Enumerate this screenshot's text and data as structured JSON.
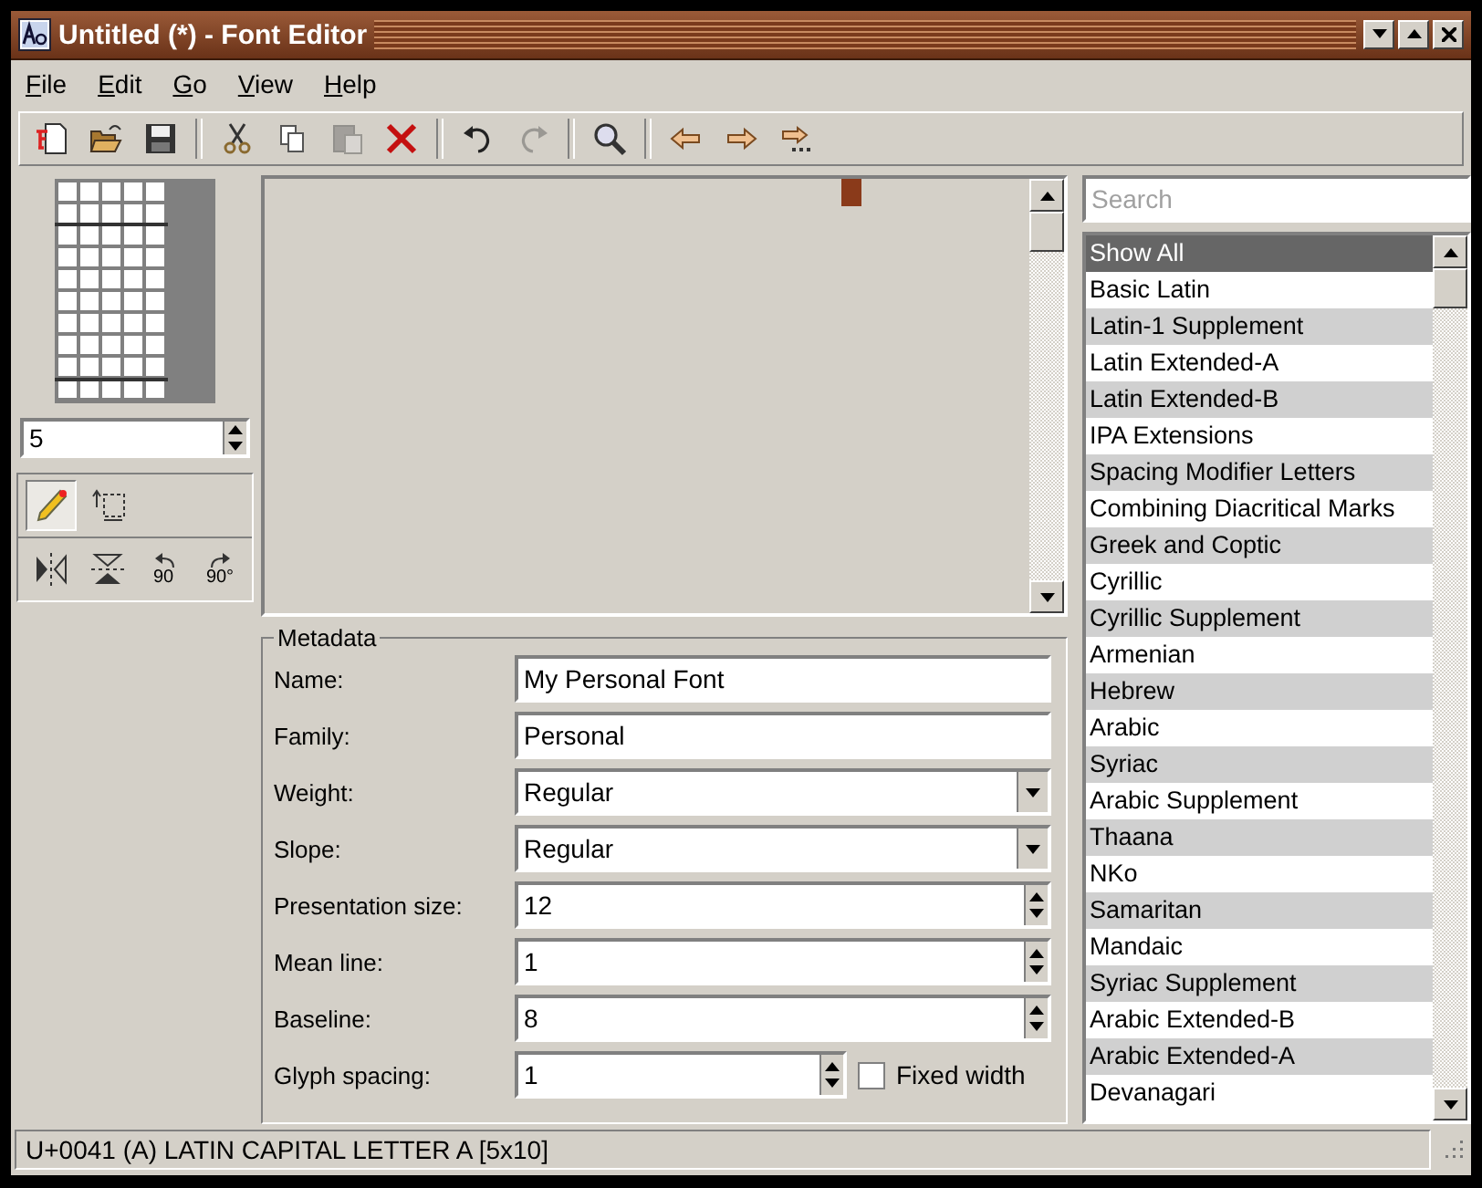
{
  "window": {
    "title": "Untitled (*) - Font Editor"
  },
  "menu": [
    "File",
    "Edit",
    "Go",
    "View",
    "Help"
  ],
  "toolbar": [
    {
      "kind": "new",
      "disabled": false
    },
    {
      "kind": "open",
      "disabled": false
    },
    {
      "kind": "save",
      "disabled": false
    },
    {
      "kind": "sep"
    },
    {
      "kind": "cut",
      "disabled": false
    },
    {
      "kind": "copy",
      "disabled": false
    },
    {
      "kind": "paste",
      "disabled": true
    },
    {
      "kind": "delete",
      "disabled": false
    },
    {
      "kind": "sep"
    },
    {
      "kind": "undo",
      "disabled": false
    },
    {
      "kind": "redo",
      "disabled": true
    },
    {
      "kind": "sep"
    },
    {
      "kind": "find",
      "disabled": false
    },
    {
      "kind": "sep"
    },
    {
      "kind": "back",
      "disabled": false
    },
    {
      "kind": "forward",
      "disabled": false
    },
    {
      "kind": "goto",
      "disabled": false
    }
  ],
  "glyph_width": {
    "value": "5"
  },
  "draw_tools": [
    {
      "kind": "pencil",
      "selected": true
    },
    {
      "kind": "select",
      "selected": false
    }
  ],
  "transform_tools": [
    {
      "kind": "flip-h"
    },
    {
      "kind": "flip-v"
    },
    {
      "kind": "rotate-left",
      "label": "90"
    },
    {
      "kind": "rotate-right",
      "label": "90°"
    }
  ],
  "metadata": {
    "title": "Metadata",
    "fields": [
      {
        "label": "Name:",
        "kind": "text",
        "value": "My Personal Font"
      },
      {
        "label": "Family:",
        "kind": "text",
        "value": "Personal"
      },
      {
        "label": "Weight:",
        "kind": "select",
        "value": "Regular"
      },
      {
        "label": "Slope:",
        "kind": "select",
        "value": "Regular"
      },
      {
        "label": "Presentation size:",
        "kind": "spin",
        "value": "12"
      },
      {
        "label": "Mean line:",
        "kind": "spin",
        "value": "1"
      },
      {
        "label": "Baseline:",
        "kind": "spin",
        "value": "8"
      },
      {
        "label": "Glyph spacing:",
        "kind": "spin-check",
        "value": "1",
        "check_label": "Fixed width",
        "checked": false
      }
    ]
  },
  "search": {
    "placeholder": "Search"
  },
  "blocks": [
    {
      "label": "Show All",
      "selected": true
    },
    {
      "label": "Basic Latin",
      "selected": false
    },
    {
      "label": "Latin-1 Supplement",
      "selected": false
    },
    {
      "label": "Latin Extended-A",
      "selected": false
    },
    {
      "label": "Latin Extended-B",
      "selected": false
    },
    {
      "label": "IPA Extensions",
      "selected": false
    },
    {
      "label": "Spacing Modifier Letters",
      "selected": false
    },
    {
      "label": "Combining Diacritical Marks",
      "selected": false
    },
    {
      "label": "Greek and Coptic",
      "selected": false
    },
    {
      "label": "Cyrillic",
      "selected": false
    },
    {
      "label": "Cyrillic Supplement",
      "selected": false
    },
    {
      "label": "Armenian",
      "selected": false
    },
    {
      "label": "Hebrew",
      "selected": false
    },
    {
      "label": "Arabic",
      "selected": false
    },
    {
      "label": "Syriac",
      "selected": false
    },
    {
      "label": "Arabic Supplement",
      "selected": false
    },
    {
      "label": "Thaana",
      "selected": false
    },
    {
      "label": "NKo",
      "selected": false
    },
    {
      "label": "Samaritan",
      "selected": false
    },
    {
      "label": "Mandaic",
      "selected": false
    },
    {
      "label": "Syriac Supplement",
      "selected": false
    },
    {
      "label": "Arabic Extended-B",
      "selected": false
    },
    {
      "label": "Arabic Extended-A",
      "selected": false
    },
    {
      "label": "Devanagari",
      "selected": false
    }
  ],
  "status_bar": "U+0041 (A) LATIN CAPITAL LETTER A [5x10]"
}
